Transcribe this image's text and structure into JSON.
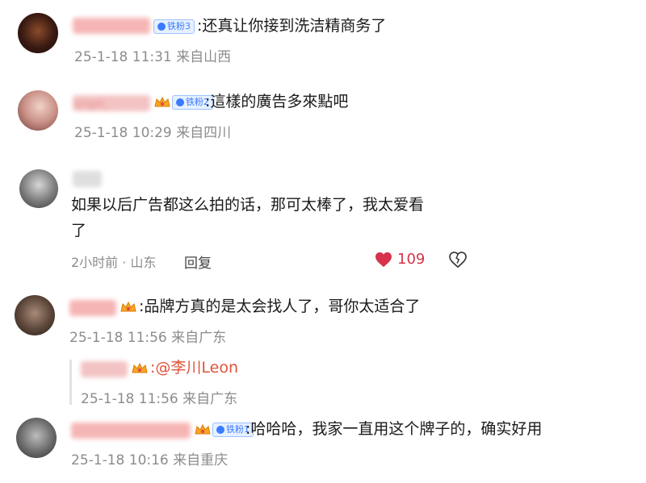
{
  "comments": [
    {
      "badge": "铁粉3",
      "text": ":还真让你接到洗洁精商务了",
      "meta": "25-1-18 11:31 来自山西"
    },
    {
      "name": "angel_",
      "badge": "铁粉2",
      "text": ":這樣的廣告多來點吧",
      "meta": "25-1-18 10:29 来自四川"
    },
    {
      "text_line1": "如果以后广告都这么拍的话，那可太棒了，我太爱看",
      "text_line2": "了",
      "time": "2小时前 · 山东",
      "reply_label": "回复",
      "likes": "109"
    },
    {
      "text": ":品牌方真的是太会找人了，哥你太适合了",
      "meta": "25-1-18 11:56 来自广东"
    },
    {
      "mention": ":@李川Leon",
      "meta": "25-1-18 11:56 来自广东"
    },
    {
      "badge": "铁粉1",
      "text": ":哈哈哈，我家一直用这个牌子的，确实好用",
      "meta": "25-1-18 10:16 来自重庆"
    }
  ],
  "colors": {
    "accent_red": "#d6324b",
    "meta_gray": "#8c8c8c",
    "badge_blue": "#3a7bff",
    "mention": "#e0533a"
  }
}
